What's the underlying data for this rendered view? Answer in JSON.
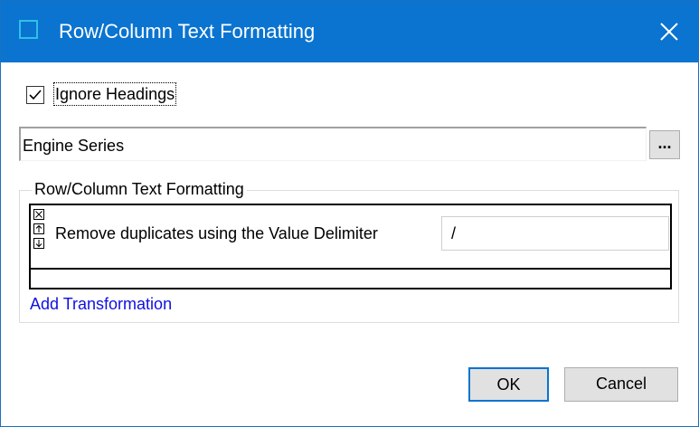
{
  "window": {
    "title": "Row/Column Text Formatting",
    "colors": {
      "titlebar": "#0a74d0",
      "accent_border": "#0a74d0",
      "link": "#1010e0"
    }
  },
  "options": {
    "ignore_headings_label": "Ignore Headings",
    "ignore_headings_checked": true
  },
  "field": {
    "value": "Engine Series",
    "browse_label": "..."
  },
  "group": {
    "legend": "Row/Column Text Formatting",
    "transformations": [
      {
        "label": "Remove duplicates using the Value Delimiter",
        "delimiter": "/"
      }
    ],
    "add_link": "Add Transformation"
  },
  "buttons": {
    "ok": "OK",
    "cancel": "Cancel"
  },
  "icons": {
    "app": "window-icon",
    "close": "close-icon",
    "check": "checkmark-icon",
    "remove": "remove-x-icon",
    "move_up": "arrow-up-icon",
    "move_down": "arrow-down-icon"
  }
}
